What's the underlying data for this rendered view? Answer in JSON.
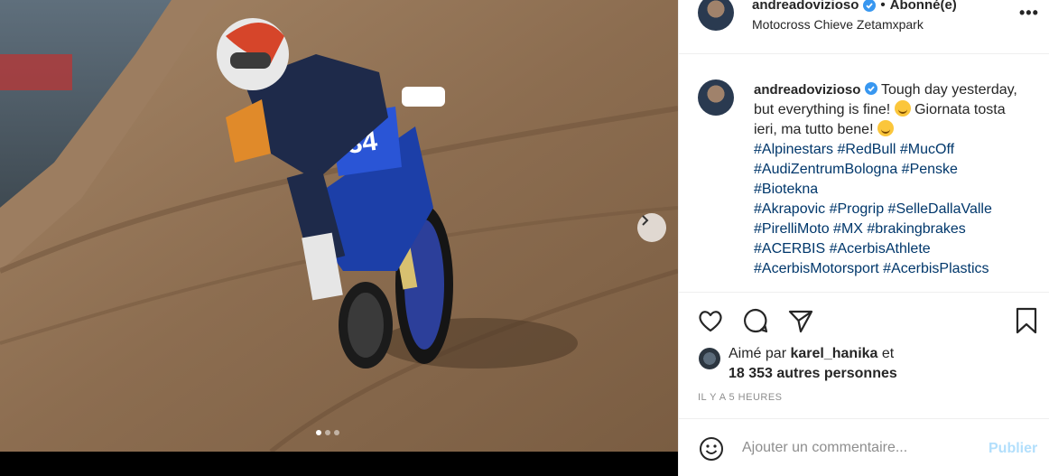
{
  "post": {
    "username": "andreadovizioso",
    "separator": "•",
    "follow_status": "Abonné(e)",
    "location": "Motocross Chieve Zetamxpark",
    "more_label": "•••"
  },
  "caption": {
    "username": "andreadovizioso",
    "text_1": "Tough day yesterday, but everything is fine!",
    "text_2": "Giornata tosta ieri, ma tutto bene!",
    "hashtags": [
      "#Alpinestars",
      "#RedBull",
      "#MucOff",
      "#AudiZentrumBologna",
      "#Penske",
      "#Biotekna",
      "#Akrapovic",
      "#Progrip",
      "#SelleDallaValle",
      "#PirelliMoto",
      "#MX",
      "#brakingbrakes",
      "#ACERBIS",
      "#AcerbisAthlete",
      "#AcerbisMotorsport",
      "#AcerbisPlastics"
    ]
  },
  "likes": {
    "prefix": "Aimé par",
    "user": "karel_hanika",
    "suffix": "et",
    "others": "18 353 autres personnes"
  },
  "timestamp": "IL Y A 5 HEURES",
  "comment": {
    "placeholder": "Ajouter un commentaire...",
    "publish_label": "Publier"
  },
  "media": {
    "bike_number": "634",
    "slide_count": 3,
    "active_slide": 1
  },
  "icons": {
    "like": "heart-icon",
    "comment": "comment-bubble-icon",
    "share": "paper-plane-icon",
    "save": "bookmark-icon",
    "emoji": "smiley-icon",
    "next": "chevron-right-icon",
    "verified": "verified-badge-icon"
  },
  "colors": {
    "hashtag": "#00376b",
    "verified": "#3897f0",
    "publish_disabled": "#b2dffc",
    "muted": "#8e8e8e",
    "bike_blue": "#1c3fa8"
  }
}
